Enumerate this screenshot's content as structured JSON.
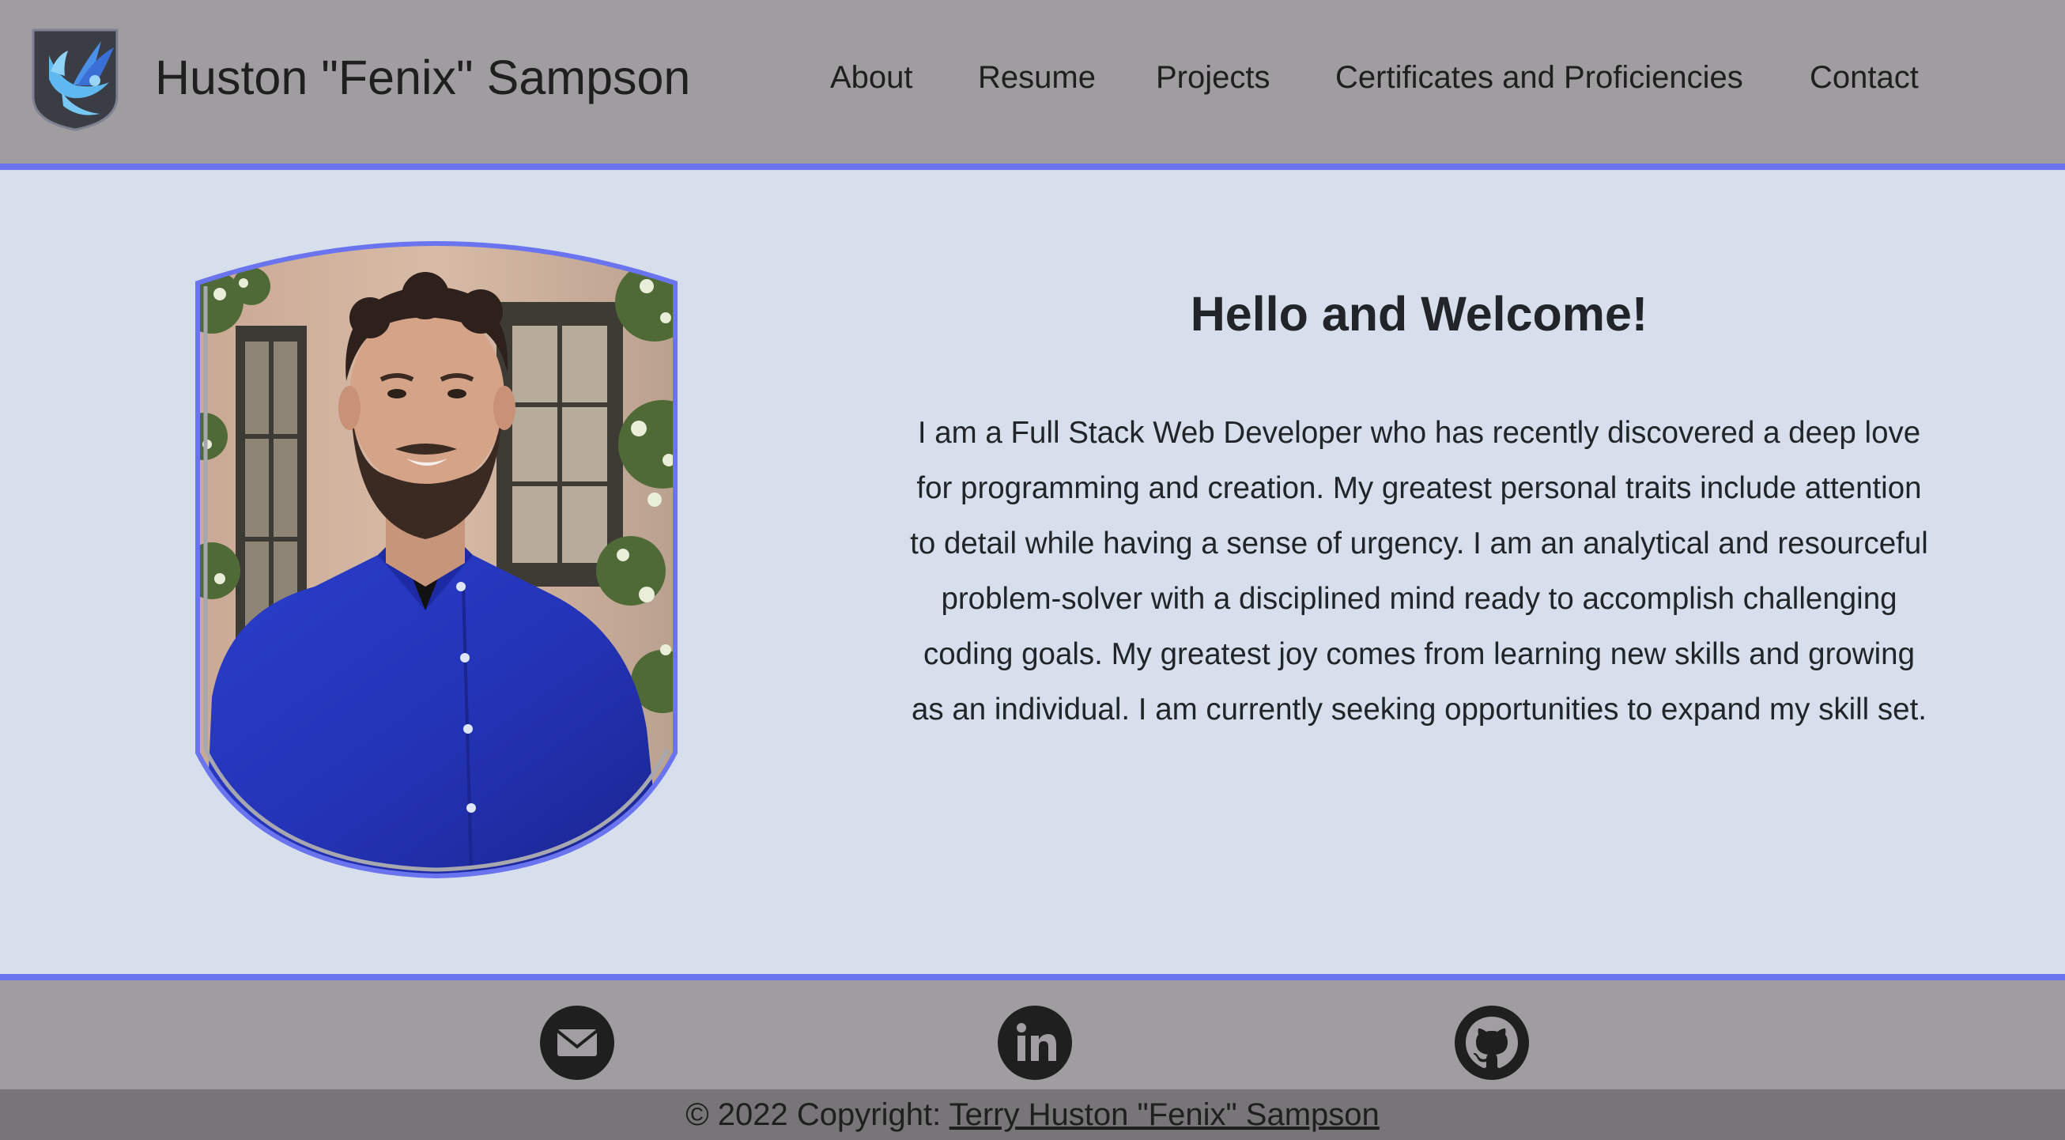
{
  "header": {
    "brand": "Huston \"Fenix\" Sampson",
    "logo_icon": "phoenix-shield-logo",
    "nav": {
      "about": "About",
      "resume": "Resume",
      "projects": "Projects",
      "certificates": "Certificates and Proficiencies",
      "contact": "Contact"
    }
  },
  "main": {
    "title": "Hello and Welcome!",
    "body": "I am a Full Stack Web Developer who has recently discovered a deep love for programming and creation. My greatest personal traits include attention to detail while having a sense of urgency. I am an analytical and resourceful problem-solver with a disciplined mind ready to accomplish challenging coding goals. My greatest joy comes from learning new skills and growing as an individual. I am currently seeking opportunities to expand my skill set."
  },
  "footer": {
    "icons": [
      "email-icon",
      "linkedin-icon",
      "github-icon"
    ],
    "copyright_prefix": "© 2022 Copyright:",
    "copyright_name": "Terry Huston \"Fenix\" Sampson"
  },
  "colors": {
    "header_bg": "#9f9d9f",
    "main_bg": "#d6dfeb",
    "accent": "#6a74ef",
    "copyright_bg": "#777577",
    "text": "#212529"
  }
}
